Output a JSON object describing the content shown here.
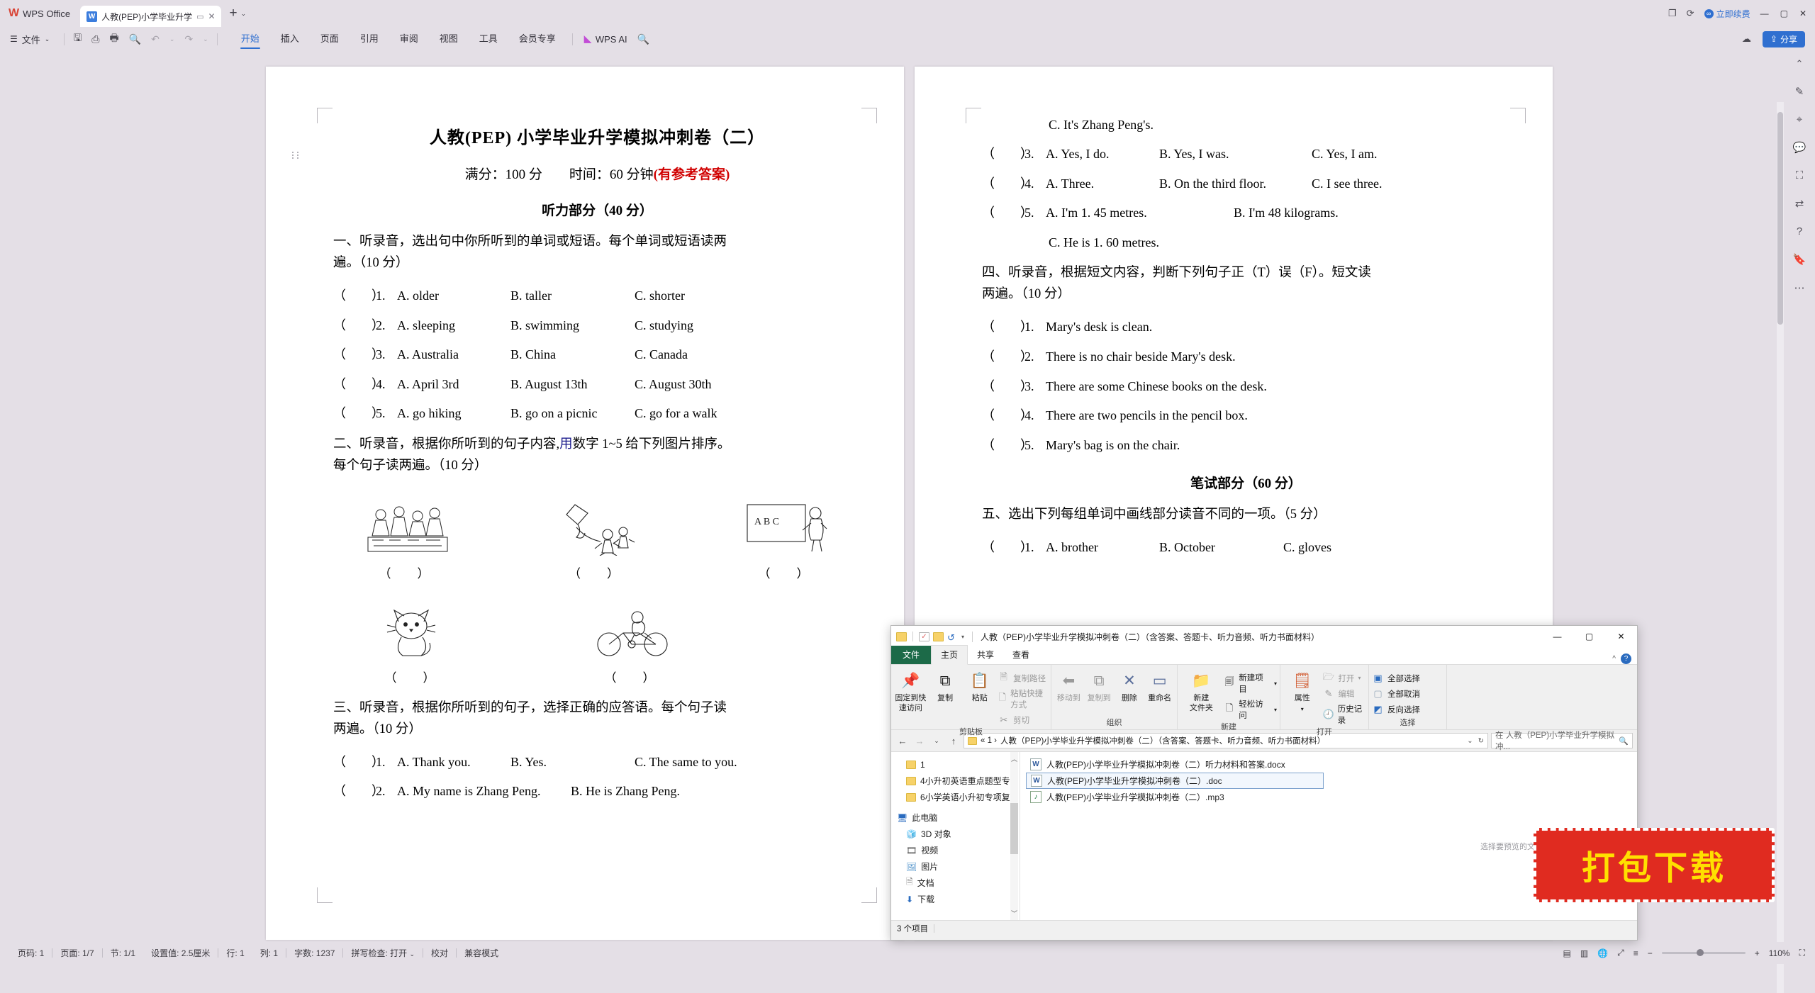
{
  "app": {
    "name": "WPS Office",
    "tab": {
      "title": "人教(PEP)小学毕业升学模拟冲",
      "icon": "W"
    },
    "tab_add": "+",
    "tab_add_chevron": "⌄",
    "vip_label": "立即续费",
    "share_label": "分享"
  },
  "ribbon": {
    "file_menu": "文件",
    "quick_icons": [
      "save-icon",
      "cloud-save-icon",
      "print-icon",
      "print-preview-icon",
      "undo-icon",
      "redo-icon"
    ],
    "tabs": [
      {
        "label": "开始",
        "active": true
      },
      {
        "label": "插入",
        "active": false
      },
      {
        "label": "页面",
        "active": false
      },
      {
        "label": "引用",
        "active": false
      },
      {
        "label": "审阅",
        "active": false
      },
      {
        "label": "视图",
        "active": false
      },
      {
        "label": "工具",
        "active": false
      },
      {
        "label": "会员专享",
        "active": false
      }
    ],
    "ai_label": "WPS AI"
  },
  "document": {
    "page1": {
      "title": "人教(PEP)  小学毕业升学模拟冲刺卷（二）",
      "subtitle_plain": "满分：100 分　　时间：60 分钟",
      "subtitle_red": "(有参考答案)",
      "section_heading": "听力部分（40 分）",
      "q1_prompt_line1": "一、听录音，选出句中你所听到的单词或短语。每个单词或短语读两",
      "q1_prompt_line2": "遍。（10 分）",
      "q1_items": [
        {
          "num": "1.",
          "a": "A. older",
          "b": "B. taller",
          "c": "C. shorter"
        },
        {
          "num": "2.",
          "a": "A. sleeping",
          "b": "B. swimming",
          "c": "C. studying"
        },
        {
          "num": "3.",
          "a": "A. Australia",
          "b": "B. China",
          "c": "C. Canada"
        },
        {
          "num": "4.",
          "a": "A. April 3rd",
          "b": "B. August 13th",
          "c": "C. August 30th"
        },
        {
          "num": "5.",
          "a": "A. go hiking",
          "b": "B. go on a picnic",
          "c": "C. go for a walk"
        }
      ],
      "q2_prompt_pre": "二、听录音，根据你所听到的句子内容,",
      "q2_prompt_blue": "用",
      "q2_prompt_post": "数字 1~5 给下列图片排序。",
      "q2_prompt_line2": "每个句子读两遍。（10 分）",
      "picture_caption": "（　）",
      "pictures": [
        "classroom-students-drawing",
        "kite-flying-drawing",
        "blackboard-teacher-drawing",
        "cat-drawing",
        "bicycle-rider-drawing"
      ],
      "q3_prompt_line1": "三、听录音，根据你所听到的句子，选择正确的应答语。每个句子读",
      "q3_prompt_line2": "两遍。（10 分）",
      "q3_items": [
        {
          "num": "1.",
          "a": "A. Thank you.",
          "b": "B. Yes.",
          "c": "C. The same to you."
        },
        {
          "num": "2.",
          "a": "A. My name is Zhang Peng.",
          "b": "B. He is Zhang Peng.",
          "c": ""
        }
      ],
      "paren": "（　　）"
    },
    "page2": {
      "cont_line": "C. It's Zhang Peng's.",
      "q3_items": [
        {
          "num": "3.",
          "a": "A. Yes, I do.",
          "b": "B. Yes, I was.",
          "c": "C. Yes, I am."
        },
        {
          "num": "4.",
          "a": "A. Three.",
          "b": "B. On the third floor.",
          "c": "C. I see three."
        },
        {
          "num": "5.",
          "a": "A. I'm 1. 45 metres.",
          "b": "B. I'm 48 kilograms.",
          "c": ""
        }
      ],
      "q5_cont": "C. He is 1. 60 metres.",
      "q4_prompt_line1": "四、听录音，根据短文内容，判断下列句子正（T）误（F）。短文读",
      "q4_prompt_line2": "两遍。（10 分）",
      "q4_items": [
        {
          "num": "1.",
          "text": "Mary's desk is clean."
        },
        {
          "num": "2.",
          "text": "There is no chair beside Mary's desk."
        },
        {
          "num": "3.",
          "text": "There are some Chinese books on the desk."
        },
        {
          "num": "4.",
          "text": "There are two pencils in the pencil box."
        },
        {
          "num": "5.",
          "text": "Mary's bag is on the chair."
        }
      ],
      "section_heading": "笔试部分（60 分）",
      "q5_prompt": "五、选出下列每组单词中画线部分读音不同的一项。（5 分）",
      "q5_items": [
        {
          "num": "1.",
          "a": "A. brother",
          "b": "B. October",
          "c": "C. gloves"
        }
      ],
      "paren": "（　　）"
    }
  },
  "status_bar": {
    "items": [
      "页码: 1",
      "页面: 1/7",
      "节: 1/1",
      "设置值: 2.5厘米",
      "行: 1",
      "列: 1",
      "字数: 1237",
      "拼写检查: 打开",
      "校对",
      "兼容模式"
    ],
    "spell_chevron": "⌄",
    "zoom_level": "110%",
    "zoom_minus": "−",
    "zoom_plus": "+",
    "view_icons": [
      "print-layout-icon",
      "reading-layout-icon",
      "web-layout-icon",
      "fullscreen-icon",
      "outline-icon"
    ]
  },
  "explorer": {
    "title": "人教（PEP)小学毕业升学模拟冲刺卷（二）（含答案、答题卡、听力音频、听力书面材料）",
    "qat": [
      "folder-icon",
      "properties-icon",
      "new-folder-icon",
      "undo-icon"
    ],
    "window_buttons": {
      "minimize": "—",
      "maximize": "▢",
      "close": "✕"
    },
    "tabs": [
      {
        "label": "文件",
        "kind": "file"
      },
      {
        "label": "主页",
        "kind": "active"
      },
      {
        "label": "共享",
        "kind": "normal"
      },
      {
        "label": "查看",
        "kind": "normal"
      }
    ],
    "help": "?",
    "collapse_caret": "^",
    "ribbon_groups": [
      {
        "label": "剪贴板",
        "big": [
          {
            "label": "固定到快\n速访问",
            "icon": "pin-icon"
          },
          {
            "label": "复制",
            "icon": "copy-icon"
          },
          {
            "label": "粘贴",
            "icon": "paste-icon"
          }
        ],
        "small": [
          {
            "label": "复制路径",
            "icon": "copy-path-icon",
            "dim": true
          },
          {
            "label": "粘贴快捷方式",
            "icon": "paste-shortcut-icon",
            "dim": true
          },
          {
            "label": "剪切",
            "icon": "cut-icon",
            "dim": true
          }
        ]
      },
      {
        "label": "组织",
        "big": [
          {
            "label": "移动到",
            "icon": "move-to-icon",
            "dim": true
          },
          {
            "label": "复制到",
            "icon": "copy-to-icon",
            "dim": true
          },
          {
            "label": "删除",
            "icon": "delete-icon"
          },
          {
            "label": "重命名",
            "icon": "rename-icon"
          }
        ],
        "small": []
      },
      {
        "label": "新建",
        "big": [
          {
            "label": "新建\n文件夹",
            "icon": "new-folder-icon"
          }
        ],
        "small": [
          {
            "label": "新建项目",
            "icon": "new-item-icon",
            "caret": true
          },
          {
            "label": "轻松访问",
            "icon": "easy-access-icon",
            "caret": true
          }
        ]
      },
      {
        "label": "打开",
        "big": [
          {
            "label": "属性",
            "icon": "properties-icon"
          }
        ],
        "small": [
          {
            "label": "打开",
            "icon": "open-icon",
            "caret": true,
            "dim": true
          },
          {
            "label": "编辑",
            "icon": "edit-icon",
            "dim": true
          },
          {
            "label": "历史记录",
            "icon": "history-icon"
          }
        ]
      },
      {
        "label": "选择",
        "big": [],
        "small": [
          {
            "label": "全部选择",
            "icon": "select-all-icon"
          },
          {
            "label": "全部取消",
            "icon": "select-none-icon"
          },
          {
            "label": "反向选择",
            "icon": "invert-selection-icon"
          }
        ]
      }
    ],
    "address": {
      "back": "←",
      "forward": "→",
      "recent": "⌄",
      "up": "↑",
      "breadcrumb_root": "« 1 ›",
      "path": "人教（PEP)小学毕业升学模拟冲刺卷（二）（含答案、答题卡、听力音频、听力书面材料）",
      "dropdown": "⌄",
      "refresh": "↻",
      "search_placeholder": "在 人教（PEP)小学毕业升学模拟冲..."
    },
    "nav_items": [
      {
        "label": "1",
        "icon": "folder-icon",
        "type": "folder"
      },
      {
        "label": "4小升初英语重点题型专",
        "icon": "folder-icon",
        "type": "folder"
      },
      {
        "label": "6小学英语小升初专项复",
        "icon": "folder-icon",
        "type": "folder"
      },
      {
        "label": "此电脑",
        "icon": "this-pc-icon",
        "type": "root"
      },
      {
        "label": "3D 对象",
        "icon": "3d-objects-icon",
        "type": "child"
      },
      {
        "label": "视频",
        "icon": "videos-icon",
        "type": "child"
      },
      {
        "label": "图片",
        "icon": "pictures-icon",
        "type": "child"
      },
      {
        "label": "文档",
        "icon": "documents-icon",
        "type": "child"
      },
      {
        "label": "下载",
        "icon": "downloads-icon",
        "type": "child"
      }
    ],
    "files": [
      {
        "name": "人教(PEP)小学毕业升学模拟冲刺卷（二）听力材料和答案.docx",
        "icon": "word-icon",
        "selected": false
      },
      {
        "name": "人教(PEP)小学毕业升学模拟冲刺卷（二）.doc",
        "icon": "word-icon",
        "selected": true
      },
      {
        "name": "人教(PEP)小学毕业升学模拟冲刺卷（二）.mp3",
        "icon": "mp3-icon",
        "selected": false
      }
    ],
    "status": "3 个项目"
  },
  "overlay": {
    "stamp_text": "打包下载",
    "hint": "选择要预览的文件"
  },
  "colors": {
    "accent": "#2f6fd0",
    "wps_red": "#d94436",
    "stamp_red": "#e02b20",
    "stamp_yellow": "#ffe000",
    "explorer_green": "#1c6a48"
  }
}
